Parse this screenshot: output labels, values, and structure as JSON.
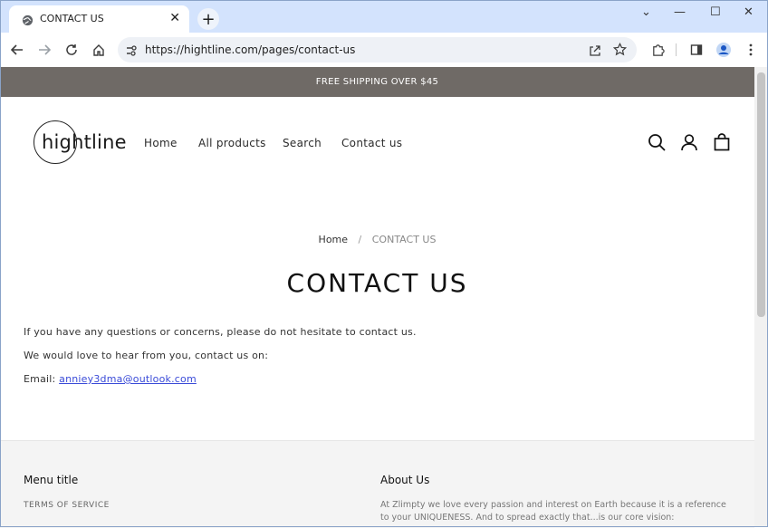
{
  "browser": {
    "tab_title": "CONTACT US",
    "tab_close": "✕",
    "new_tab": "+",
    "url": "https://hightline.com/pages/contact-us",
    "window_controls": {
      "minimize": "—",
      "maximize": "☐",
      "close": "✕",
      "tab_search": "⌄"
    }
  },
  "announcement": "FREE SHIPPING OVER $45",
  "header": {
    "logo_text": "hightline",
    "nav": [
      "Home",
      "All products",
      "Search",
      "Contact us"
    ]
  },
  "breadcrumb": {
    "home": "Home",
    "separator": "/",
    "current": "CONTACT US"
  },
  "page_title": "CONTACT US",
  "content": {
    "line1": "If you have any questions or concerns, please do not hesitate to contact us.",
    "line2": "We would love to hear from you, contact us on:",
    "email_label": "Email: ",
    "email": "anniey3dma@outlook.com"
  },
  "footer": {
    "menu_title": "Menu title",
    "menu_links": [
      "TERMS OF SERVICE"
    ],
    "about_title": "About Us",
    "about_text": "At Zlimpty we love every passion and interest on Earth because it is a reference to your UNIQUENESS. And to spread exactly that...is our core vision:"
  },
  "colors": {
    "announce_bg": "#6f6a66",
    "link": "#3a4bd8",
    "titlebar": "#d3e3fd"
  }
}
